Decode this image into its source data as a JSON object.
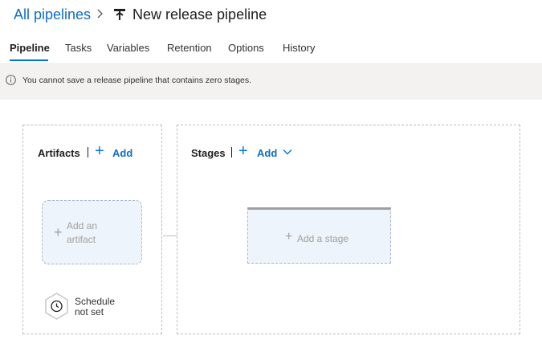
{
  "breadcrumb": {
    "parent": "All pipelines",
    "title": "New release pipeline"
  },
  "tabs": [
    {
      "label": "Pipeline",
      "active": true
    },
    {
      "label": "Tasks",
      "active": false
    },
    {
      "label": "Variables",
      "active": false
    },
    {
      "label": "Retention",
      "active": false
    },
    {
      "label": "Options",
      "active": false
    },
    {
      "label": "History",
      "active": false
    }
  ],
  "info": {
    "message": "You cannot save a release pipeline that contains zero stages."
  },
  "artifacts": {
    "title": "Artifacts",
    "add_label": "Add",
    "add_artifact_label": "Add an\nartifact",
    "schedule_label": "Schedule\nnot set"
  },
  "stages": {
    "title": "Stages",
    "add_label": "Add",
    "add_stage_label": "Add a stage"
  },
  "colors": {
    "accent": "#0078d4",
    "link": "#106ebe",
    "card_bg": "#eef4fc",
    "info_bg": "#f3f2f1"
  },
  "icons": [
    "chevron-right-icon",
    "pipeline-icon",
    "info-icon",
    "plus-icon",
    "chevron-down-icon",
    "clock-icon"
  ]
}
